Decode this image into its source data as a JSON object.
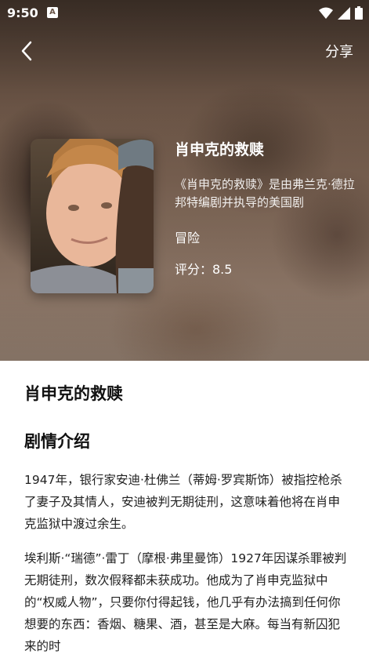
{
  "status_bar": {
    "time": "9:50",
    "notification_icon_letter": "A",
    "icons": [
      "wifi-icon",
      "signal-icon",
      "battery-icon"
    ]
  },
  "nav": {
    "back_icon": "chevron-left-icon",
    "share_label": "分享"
  },
  "movie": {
    "title": "肖申克的救赎",
    "description": "《肖申克的救赎》是由弗兰克·德拉邦特编剧并执导的美国剧",
    "genre": "冒险",
    "rating": "评分：8.5"
  },
  "detail": {
    "title": "肖申克的救赎",
    "section_title": "剧情介绍",
    "paragraphs": [
      "1947年，银行家安迪·杜佛兰（蒂姆·罗宾斯饰）被指控枪杀了妻子及其情人，安迪被判无期徒刑，这意味着他将在肖申克监狱中渡过余生。",
      "埃利斯·“瑞德”·雷丁（摩根·弗里曼饰）1927年因谋杀罪被判无期徒刑，数次假释都未获成功。他成为了肖申克监狱中的“权威人物”，只要你付得起钱，他几乎有办法搞到任何你想要的东西：香烟、糖果、酒，甚至是大麻。每当有新囚犯来的时"
    ]
  },
  "colors": {
    "hero_bg": "#6d5647",
    "text_light": "#ffffff",
    "text_dark": "#111111"
  }
}
